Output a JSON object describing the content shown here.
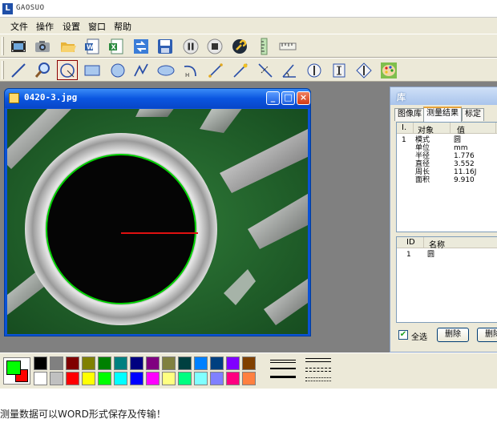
{
  "app": {
    "title": "GAOSUO"
  },
  "menu": [
    "文件",
    "操作",
    "设置",
    "窗口",
    "帮助"
  ],
  "toolbar1": [
    "film-icon",
    "camera-icon",
    "open-folder-icon",
    "word-doc-icon",
    "excel-doc-icon",
    "transfer-icon",
    "save-icon",
    "pause-icon",
    "stop-icon",
    "settings-wrench-icon",
    "vertical-ruler-icon",
    "horizontal-ruler-icon"
  ],
  "toolbar2": [
    "line-tool-icon",
    "zoom-tool-icon",
    "circle-3point-tool-icon",
    "rectangle-tool-icon",
    "circle-tool-icon",
    "polyline-tool-icon",
    "ellipse-tool-icon",
    "arc-tool-icon",
    "segment-tool-icon",
    "point-distance-tool-icon",
    "point-line-tool-icon",
    "angle-tool-icon",
    "vertical-distance-tool-icon",
    "horizontal-distance-tool-icon",
    "diamond-distance-tool-icon",
    "palette-tool-icon"
  ],
  "image_window": {
    "title": "0420-3.jpg",
    "btn_min": "_",
    "btn_max": "□",
    "btn_close": "×"
  },
  "panel": {
    "title": "库",
    "tabs": [
      "图像库",
      "测量结果",
      "标定"
    ],
    "active_tab": 1,
    "results_headers": [
      "I.",
      "对象",
      "值"
    ],
    "results_rows": [
      {
        "id": "1",
        "name": "模式",
        "value": "圆"
      },
      {
        "id": "",
        "name": "单位",
        "value": "mm"
      },
      {
        "id": "",
        "name": "半径",
        "value": "1.776"
      },
      {
        "id": "",
        "name": "直径",
        "value": "3.552"
      },
      {
        "id": "",
        "name": "周长",
        "value": "11.16J"
      },
      {
        "id": "",
        "name": "面积",
        "value": "9.910"
      }
    ],
    "objects_headers": [
      "ID",
      "名称"
    ],
    "objects_rows": [
      {
        "id": "1",
        "name": "圆"
      }
    ],
    "select_all_label": "全选",
    "select_all_checked": "✔",
    "delete_button": "删除",
    "delete_all_button": "删除"
  },
  "palette": {
    "foreground": "#00ff00",
    "background": "#ff0000",
    "row1": [
      "#000000",
      "#808080",
      "#800000",
      "#808000",
      "#008000",
      "#008080",
      "#000080",
      "#800080",
      "#808040",
      "#004040",
      "#0080ff",
      "#004080",
      "#8000ff",
      "#804000"
    ],
    "row2": [
      "#ffffff",
      "#c0c0c0",
      "#ff0000",
      "#ffff00",
      "#00ff00",
      "#00ffff",
      "#0000ff",
      "#ff00ff",
      "#ffff80",
      "#00ff80",
      "#80ffff",
      "#8080ff",
      "#ff0080",
      "#ff8040"
    ]
  },
  "caption": "测量数据可以WORD形式保存及传输！"
}
